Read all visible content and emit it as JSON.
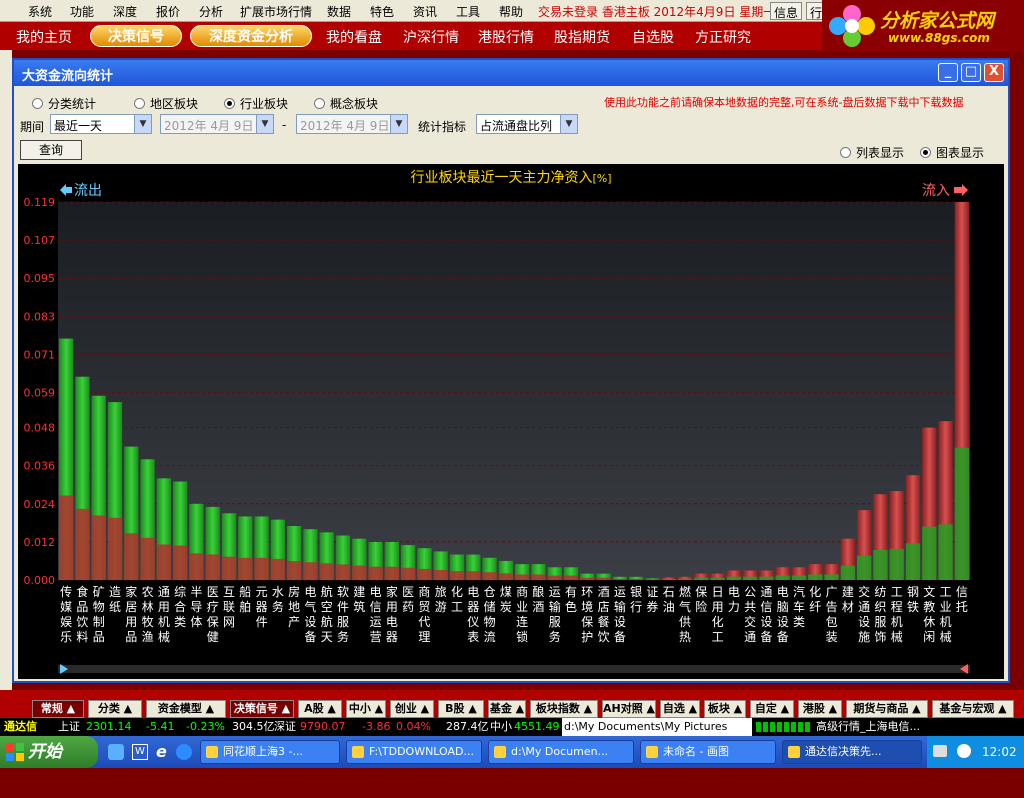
{
  "menu": {
    "items": [
      "系统",
      "功能",
      "深度",
      "报价",
      "分析",
      "扩展市场行情",
      "数据",
      "特色",
      "资讯",
      "工具",
      "帮助"
    ],
    "status": "交易未登录  香港主板  2012年4月9日  星期一",
    "buttons": [
      "信息",
      "行"
    ]
  },
  "logo": {
    "title": "分析家公式网",
    "url": "www.88gs.com"
  },
  "nav": {
    "items": [
      "我的主页",
      "决策信号",
      "深度资金分析",
      "我的看盘",
      "沪深行情",
      "港股行情",
      "股指期货",
      "自选股",
      "方正研究"
    ]
  },
  "window": {
    "title": "大资金流向统计",
    "buttons": [
      "_",
      "□",
      "X"
    ],
    "category_radios": [
      {
        "label": "分类统计",
        "selected": false
      },
      {
        "label": "地区板块",
        "selected": false
      },
      {
        "label": "行业板块",
        "selected": true
      },
      {
        "label": "概念板块",
        "selected": false
      }
    ],
    "notice": "使用此功能之前请确保本地数据的完整,可在系统-盘后数据下载中下载数据",
    "period_label": "期间",
    "period_value": "最近一天",
    "date_from": "2012年 4月 9日",
    "date_sep": "-",
    "date_to": "2012年 4月 9日",
    "metric_label": "统计指标",
    "metric_value": "占流通盘比列",
    "query_button": "查询",
    "display_radios": [
      {
        "label": "列表显示",
        "selected": false
      },
      {
        "label": "图表显示",
        "selected": true
      }
    ]
  },
  "chart_data": {
    "type": "bar",
    "title": "行业板块最近一天主力净资入",
    "title_suffix": "[%]",
    "outflow_label": "流出",
    "inflow_label": "流入",
    "yticks": [
      "0.119",
      "0.107",
      "0.095",
      "0.083",
      "0.071",
      "0.059",
      "0.048",
      "0.036",
      "0.024",
      "0.012",
      "0.000"
    ],
    "ylim": [
      0,
      0.119
    ],
    "grid": true,
    "colors": {
      "outflow": "#2db52d",
      "inflow": "#c03030",
      "title": "#ffd700"
    },
    "categories": [
      "传媒娱乐",
      "食品饮料",
      "矿物制品",
      "造纸",
      "家居用品",
      "农林牧渔",
      "通用机械",
      "综合类",
      "半导体",
      "医疗保健",
      "互联网",
      "船舶",
      "元器件",
      "水务",
      "房地产",
      "电气设备",
      "航空航天",
      "软件服务",
      "建筑",
      "电信运营",
      "家用电器",
      "医药",
      "商贸代理",
      "旅游",
      "化工",
      "电器仪表",
      "仓储物流",
      "煤炭",
      "商业连锁",
      "酿酒",
      "运输服务",
      "有色",
      "环境保护",
      "酒店餐饮",
      "运输设备",
      "银行",
      "证券",
      "石油",
      "燃气供热",
      "保险",
      "日用化工",
      "电力",
      "公共交通",
      "通信设备",
      "电脑设备",
      "汽车类",
      "化纤",
      "广告包装",
      "建材",
      "交通设施",
      "纺织服饰",
      "工程机械",
      "钢铁",
      "文教休闲",
      "工业机械",
      "信托"
    ],
    "flow": [
      "out",
      "out",
      "out",
      "out",
      "out",
      "out",
      "out",
      "out",
      "out",
      "out",
      "out",
      "out",
      "out",
      "out",
      "out",
      "out",
      "out",
      "out",
      "out",
      "out",
      "out",
      "out",
      "out",
      "out",
      "out",
      "out",
      "out",
      "out",
      "out",
      "out",
      "out",
      "out",
      "out",
      "out",
      "out",
      "out",
      "out",
      "in",
      "in",
      "in",
      "in",
      "in",
      "in",
      "in",
      "in",
      "in",
      "in",
      "in",
      "in",
      "in",
      "in",
      "in",
      "in",
      "in",
      "in",
      "in"
    ],
    "values": [
      0.076,
      0.064,
      0.058,
      0.056,
      0.042,
      0.038,
      0.032,
      0.031,
      0.024,
      0.023,
      0.021,
      0.02,
      0.02,
      0.019,
      0.017,
      0.016,
      0.015,
      0.014,
      0.013,
      0.012,
      0.012,
      0.011,
      0.01,
      0.009,
      0.008,
      0.008,
      0.007,
      0.006,
      0.005,
      0.005,
      0.004,
      0.004,
      0.002,
      0.002,
      0.001,
      0.001,
      0.0005,
      0.0008,
      0.001,
      0.002,
      0.002,
      0.003,
      0.003,
      0.003,
      0.004,
      0.004,
      0.005,
      0.005,
      0.013,
      0.022,
      0.027,
      0.028,
      0.033,
      0.048,
      0.05,
      0.119
    ]
  },
  "bottom_tabs": [
    "常规",
    "分类",
    "资金模型",
    "决策信号",
    "A股",
    "中小",
    "创业",
    "B股",
    "基金",
    "板块指数",
    "AH对照",
    "自选",
    "板块",
    "自定",
    "港股",
    "期货与商品",
    "基金与宏观"
  ],
  "ticker": {
    "brand": "通达信",
    "sh_label": "上证",
    "sh_value": "2301.14",
    "sh_change": "-5.41",
    "sh_pct": "-0.23%",
    "sh_amount": "304.5亿",
    "sz_label": "深证",
    "sz_value": "9790.07",
    "sz_change": "-3.86",
    "sz_pct": "0.04%",
    "sz_amount": "287.4亿",
    "zx_label": "中小",
    "zx_value": "4551.49",
    "path": "d:\\My Documents\\My Pictures",
    "right": "高级行情_上海电信..."
  },
  "taskbar": {
    "start": "开始",
    "tasks": [
      "同花顺上海3 -...",
      "F:\\TDDOWNLOAD...",
      "d:\\My Documen...",
      "未命名 - 画图",
      "通达信决策先..."
    ],
    "clock": "12:02"
  }
}
